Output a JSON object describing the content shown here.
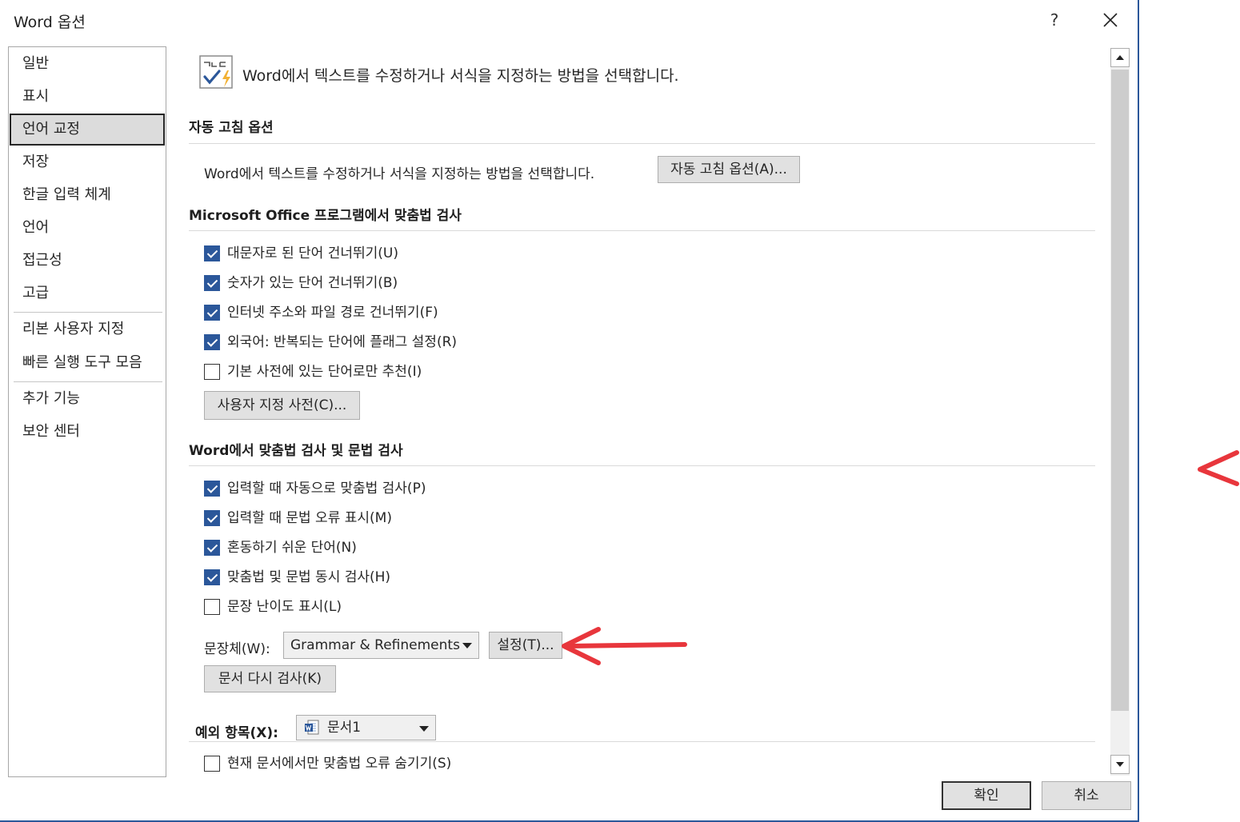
{
  "window": {
    "title": "Word 옵션",
    "help_label": "?",
    "close_icon": "close-icon"
  },
  "sidebar": {
    "items": [
      {
        "label": "일반"
      },
      {
        "label": "표시"
      },
      {
        "label": "언어 교정",
        "selected": true
      },
      {
        "label": "저장"
      },
      {
        "label": "한글 입력 체계"
      },
      {
        "label": "언어"
      },
      {
        "label": "접근성"
      },
      {
        "label": "고급"
      },
      {
        "label": "리본 사용자 지정"
      },
      {
        "label": "빠른 실행 도구 모음"
      },
      {
        "label": "추가 기능"
      },
      {
        "label": "보안 센터"
      }
    ]
  },
  "main": {
    "intro_text": "Word에서 텍스트를 수정하거나 서식을 지정하는 방법을 선택합니다.",
    "autocorrect": {
      "title": "자동 고침 옵션",
      "description": "Word에서 텍스트를 수정하거나 서식을 지정하는 방법을 선택합니다.",
      "button_label": "자동 고침 옵션(A)..."
    },
    "office_spelling": {
      "title": "Microsoft Office 프로그램에서 맞춤법 검사",
      "options": [
        {
          "label": "대문자로 된 단어 건너뛰기(U)",
          "checked": true
        },
        {
          "label": "숫자가 있는 단어 건너뛰기(B)",
          "checked": true
        },
        {
          "label": "인터넷 주소와 파일 경로 건너뛰기(F)",
          "checked": true
        },
        {
          "label": "외국어: 반복되는 단어에 플래그 설정(R)",
          "checked": true
        },
        {
          "label": "기본 사전에 있는 단어로만 추천(I)",
          "checked": false
        }
      ],
      "custom_dict_button": "사용자 지정 사전(C)..."
    },
    "word_spelling": {
      "title": "Word에서 맞춤법 검사 및 문법 검사",
      "options": [
        {
          "label": "입력할 때 자동으로 맞춤법 검사(P)",
          "checked": true
        },
        {
          "label": "입력할 때 문법 오류 표시(M)",
          "checked": true
        },
        {
          "label": "혼동하기 쉬운 단어(N)",
          "checked": true
        },
        {
          "label": "맞춤법 및 문법 동시 검사(H)",
          "checked": true
        },
        {
          "label": "문장 난이도 표시(L)",
          "checked": false
        }
      ],
      "writing_style_label": "문장체(W):",
      "writing_style_value": "Grammar & Refinements",
      "settings_button": "설정(T)...",
      "recheck_button": "문서 다시 검사(K)"
    },
    "exceptions": {
      "label": "예외 항목(X):",
      "document_value": "문서1",
      "options": [
        {
          "label": "현재 문서에서만 맞춤법 오류 숨기기(S)",
          "checked": false
        }
      ]
    }
  },
  "footer": {
    "ok_label": "확인",
    "cancel_label": "취소"
  },
  "annotation_color": "#e8363c"
}
